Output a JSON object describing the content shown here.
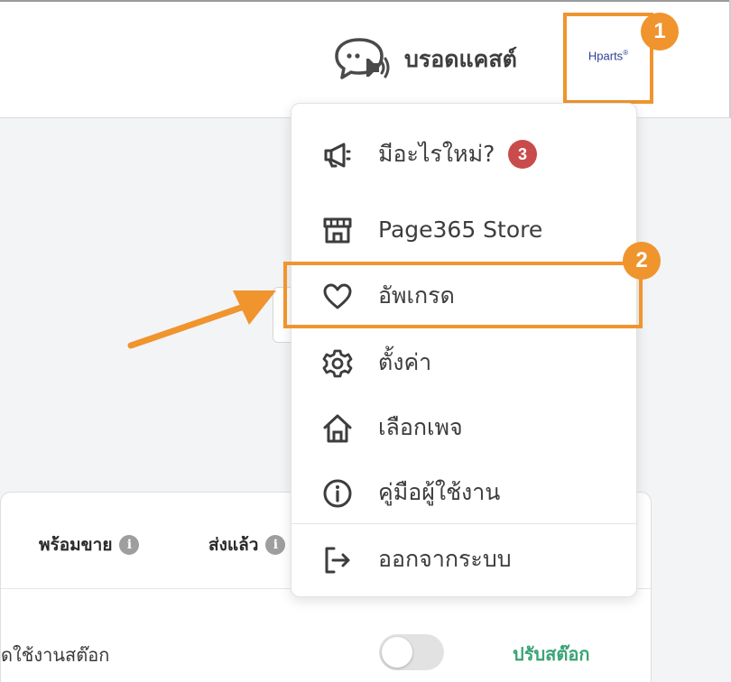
{
  "header": {
    "broadcast_label": "บรอดแคสต์",
    "brand_logo_text": "Hparts",
    "brand_logo_mark": "®"
  },
  "annotations": {
    "step1": "1",
    "step2": "2",
    "accent_color": "#f0942e"
  },
  "menu": {
    "items": [
      {
        "label": "มีอะไรใหม่?",
        "icon": "megaphone-icon",
        "badge": "3"
      },
      {
        "label": "Page365 Store",
        "icon": "store-icon"
      },
      {
        "label": "อัพเกรด",
        "icon": "heart-icon"
      },
      {
        "label": "ตั้งค่า",
        "icon": "gear-icon"
      },
      {
        "label": "เลือกเพจ",
        "icon": "home-icon"
      },
      {
        "label": "คู่มือผู้ใช้งาน",
        "icon": "info-icon"
      },
      {
        "label": "ออกจากระบบ",
        "icon": "logout-icon"
      }
    ]
  },
  "panel": {
    "stats": [
      {
        "label": "พร้อมขาย",
        "icon": "info-icon"
      },
      {
        "label": "ส่งแล้ว",
        "icon": "info-icon"
      }
    ],
    "stock_label": "ดใช้งานสต๊อก",
    "stock_toggle_on": false,
    "adjust_stock_label": "ปรับสต๊อก"
  },
  "colors": {
    "badge_red": "#c94b4b",
    "link_green": "#3aa377",
    "logo_blue": "#2c3e95"
  }
}
